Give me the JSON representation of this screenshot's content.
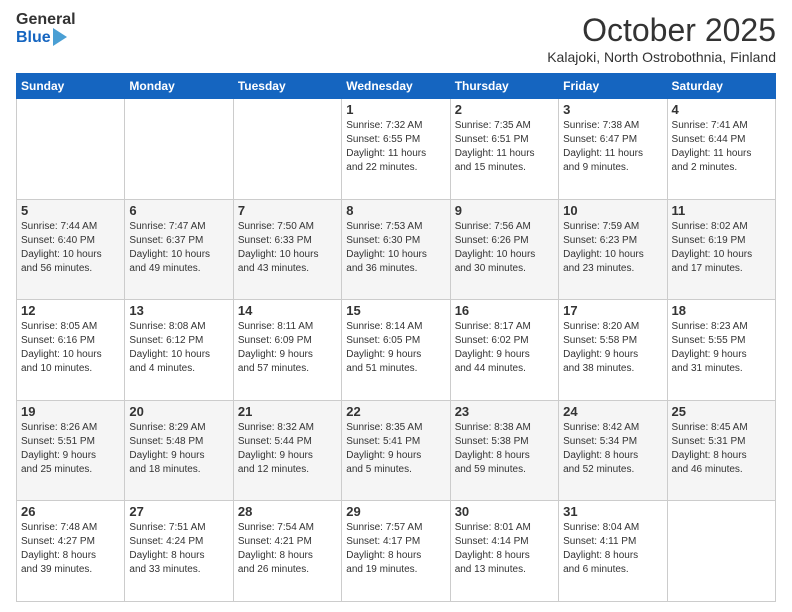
{
  "header": {
    "logo_general": "General",
    "logo_blue": "Blue",
    "month": "October 2025",
    "location": "Kalajoki, North Ostrobothnia, Finland"
  },
  "weekdays": [
    "Sunday",
    "Monday",
    "Tuesday",
    "Wednesday",
    "Thursday",
    "Friday",
    "Saturday"
  ],
  "weeks": [
    [
      {
        "day": "",
        "text": ""
      },
      {
        "day": "",
        "text": ""
      },
      {
        "day": "",
        "text": ""
      },
      {
        "day": "1",
        "text": "Sunrise: 7:32 AM\nSunset: 6:55 PM\nDaylight: 11 hours\nand 22 minutes."
      },
      {
        "day": "2",
        "text": "Sunrise: 7:35 AM\nSunset: 6:51 PM\nDaylight: 11 hours\nand 15 minutes."
      },
      {
        "day": "3",
        "text": "Sunrise: 7:38 AM\nSunset: 6:47 PM\nDaylight: 11 hours\nand 9 minutes."
      },
      {
        "day": "4",
        "text": "Sunrise: 7:41 AM\nSunset: 6:44 PM\nDaylight: 11 hours\nand 2 minutes."
      }
    ],
    [
      {
        "day": "5",
        "text": "Sunrise: 7:44 AM\nSunset: 6:40 PM\nDaylight: 10 hours\nand 56 minutes."
      },
      {
        "day": "6",
        "text": "Sunrise: 7:47 AM\nSunset: 6:37 PM\nDaylight: 10 hours\nand 49 minutes."
      },
      {
        "day": "7",
        "text": "Sunrise: 7:50 AM\nSunset: 6:33 PM\nDaylight: 10 hours\nand 43 minutes."
      },
      {
        "day": "8",
        "text": "Sunrise: 7:53 AM\nSunset: 6:30 PM\nDaylight: 10 hours\nand 36 minutes."
      },
      {
        "day": "9",
        "text": "Sunrise: 7:56 AM\nSunset: 6:26 PM\nDaylight: 10 hours\nand 30 minutes."
      },
      {
        "day": "10",
        "text": "Sunrise: 7:59 AM\nSunset: 6:23 PM\nDaylight: 10 hours\nand 23 minutes."
      },
      {
        "day": "11",
        "text": "Sunrise: 8:02 AM\nSunset: 6:19 PM\nDaylight: 10 hours\nand 17 minutes."
      }
    ],
    [
      {
        "day": "12",
        "text": "Sunrise: 8:05 AM\nSunset: 6:16 PM\nDaylight: 10 hours\nand 10 minutes."
      },
      {
        "day": "13",
        "text": "Sunrise: 8:08 AM\nSunset: 6:12 PM\nDaylight: 10 hours\nand 4 minutes."
      },
      {
        "day": "14",
        "text": "Sunrise: 8:11 AM\nSunset: 6:09 PM\nDaylight: 9 hours\nand 57 minutes."
      },
      {
        "day": "15",
        "text": "Sunrise: 8:14 AM\nSunset: 6:05 PM\nDaylight: 9 hours\nand 51 minutes."
      },
      {
        "day": "16",
        "text": "Sunrise: 8:17 AM\nSunset: 6:02 PM\nDaylight: 9 hours\nand 44 minutes."
      },
      {
        "day": "17",
        "text": "Sunrise: 8:20 AM\nSunset: 5:58 PM\nDaylight: 9 hours\nand 38 minutes."
      },
      {
        "day": "18",
        "text": "Sunrise: 8:23 AM\nSunset: 5:55 PM\nDaylight: 9 hours\nand 31 minutes."
      }
    ],
    [
      {
        "day": "19",
        "text": "Sunrise: 8:26 AM\nSunset: 5:51 PM\nDaylight: 9 hours\nand 25 minutes."
      },
      {
        "day": "20",
        "text": "Sunrise: 8:29 AM\nSunset: 5:48 PM\nDaylight: 9 hours\nand 18 minutes."
      },
      {
        "day": "21",
        "text": "Sunrise: 8:32 AM\nSunset: 5:44 PM\nDaylight: 9 hours\nand 12 minutes."
      },
      {
        "day": "22",
        "text": "Sunrise: 8:35 AM\nSunset: 5:41 PM\nDaylight: 9 hours\nand 5 minutes."
      },
      {
        "day": "23",
        "text": "Sunrise: 8:38 AM\nSunset: 5:38 PM\nDaylight: 8 hours\nand 59 minutes."
      },
      {
        "day": "24",
        "text": "Sunrise: 8:42 AM\nSunset: 5:34 PM\nDaylight: 8 hours\nand 52 minutes."
      },
      {
        "day": "25",
        "text": "Sunrise: 8:45 AM\nSunset: 5:31 PM\nDaylight: 8 hours\nand 46 minutes."
      }
    ],
    [
      {
        "day": "26",
        "text": "Sunrise: 7:48 AM\nSunset: 4:27 PM\nDaylight: 8 hours\nand 39 minutes."
      },
      {
        "day": "27",
        "text": "Sunrise: 7:51 AM\nSunset: 4:24 PM\nDaylight: 8 hours\nand 33 minutes."
      },
      {
        "day": "28",
        "text": "Sunrise: 7:54 AM\nSunset: 4:21 PM\nDaylight: 8 hours\nand 26 minutes."
      },
      {
        "day": "29",
        "text": "Sunrise: 7:57 AM\nSunset: 4:17 PM\nDaylight: 8 hours\nand 19 minutes."
      },
      {
        "day": "30",
        "text": "Sunrise: 8:01 AM\nSunset: 4:14 PM\nDaylight: 8 hours\nand 13 minutes."
      },
      {
        "day": "31",
        "text": "Sunrise: 8:04 AM\nSunset: 4:11 PM\nDaylight: 8 hours\nand 6 minutes."
      },
      {
        "day": "",
        "text": ""
      }
    ]
  ]
}
